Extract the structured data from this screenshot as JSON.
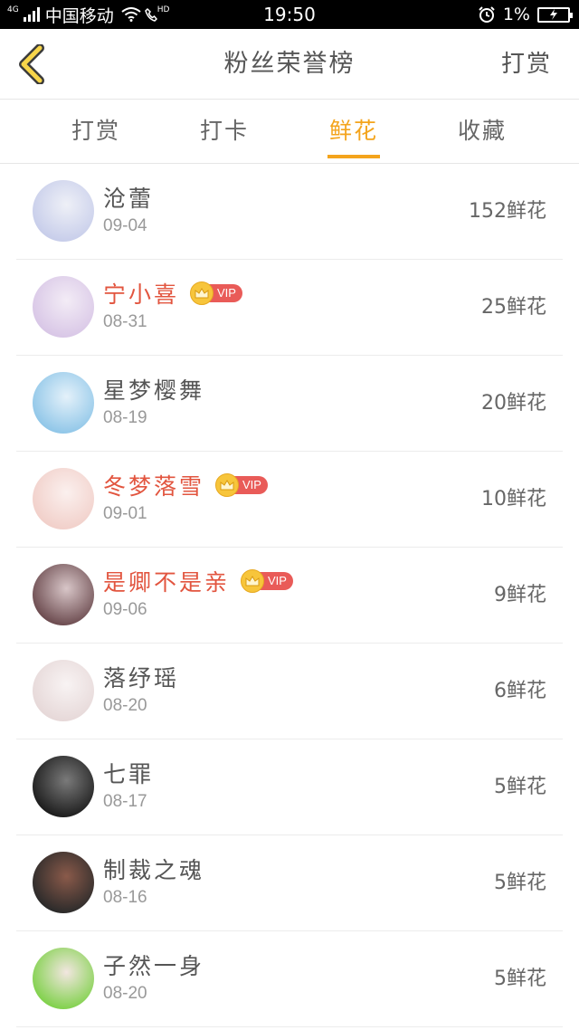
{
  "status_bar": {
    "network_label": "4G",
    "carrier": "中国移动",
    "hd_label": "HD",
    "time": "19:50",
    "battery": "1%"
  },
  "header": {
    "title": "粉丝荣誉榜",
    "action_label": "打赏",
    "accent_color": "#f4a41c"
  },
  "tabs": [
    {
      "label": "打赏",
      "active": false
    },
    {
      "label": "打卡",
      "active": false
    },
    {
      "label": "鲜花",
      "active": true
    },
    {
      "label": "收藏",
      "active": false
    }
  ],
  "list": [
    {
      "name": "沧蕾",
      "date": "09-04",
      "count": "152鲜花",
      "vip": false,
      "avatar_colors": [
        "#c7cdea",
        "#eef0f7"
      ]
    },
    {
      "name": "宁小喜",
      "date": "08-31",
      "count": "25鲜花",
      "vip": true,
      "vip_label": "VIP",
      "avatar_colors": [
        "#d8c6e6",
        "#f3ecf6"
      ]
    },
    {
      "name": "星梦樱舞",
      "date": "08-19",
      "count": "20鲜花",
      "vip": false,
      "avatar_colors": [
        "#8fc6e8",
        "#e4f1fa"
      ]
    },
    {
      "name": "冬梦落雪",
      "date": "09-01",
      "count": "10鲜花",
      "vip": true,
      "vip_label": "VIP",
      "avatar_colors": [
        "#f1cfc9",
        "#fbf0ee"
      ]
    },
    {
      "name": "是卿不是亲",
      "date": "09-06",
      "count": "9鲜花",
      "vip": true,
      "vip_label": "VIP",
      "avatar_colors": [
        "#6b4a4e",
        "#d8c6c8"
      ]
    },
    {
      "name": "落纾瑶",
      "date": "08-20",
      "count": "6鲜花",
      "vip": false,
      "avatar_colors": [
        "#e6d8d8",
        "#f8f3f3"
      ]
    },
    {
      "name": "七罪",
      "date": "08-17",
      "count": "5鲜花",
      "vip": false,
      "avatar_colors": [
        "#1c1c1c",
        "#7a7a7a"
      ]
    },
    {
      "name": "制裁之魂",
      "date": "08-16",
      "count": "5鲜花",
      "vip": false,
      "avatar_colors": [
        "#2a2a2a",
        "#8a5a4a"
      ]
    },
    {
      "name": "子然一身",
      "date": "08-20",
      "count": "5鲜花",
      "vip": false,
      "avatar_colors": [
        "#7fd14a",
        "#f2e6e0"
      ]
    }
  ]
}
